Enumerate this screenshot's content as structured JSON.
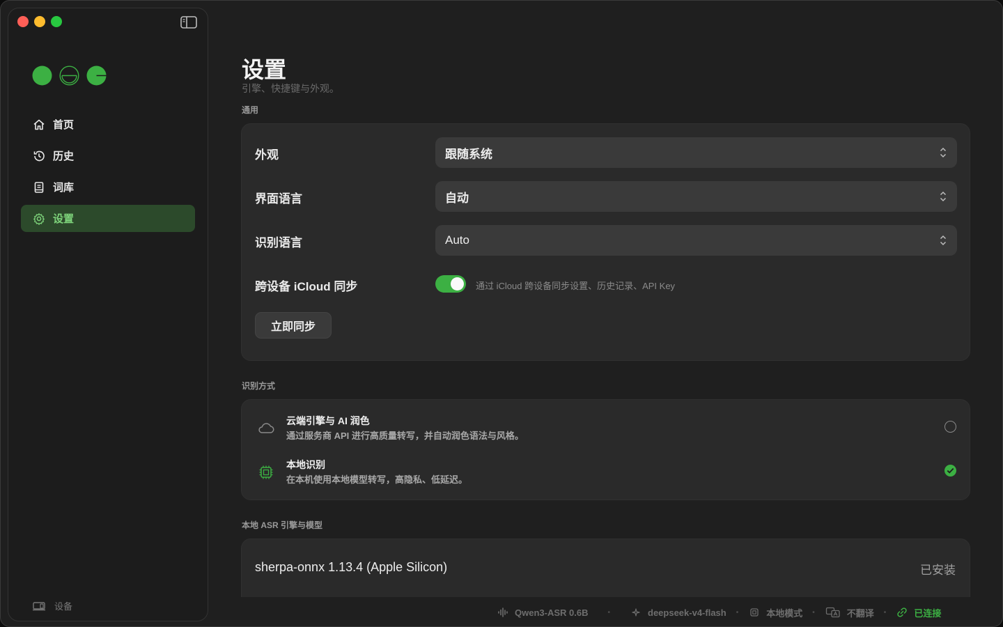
{
  "sidebar": {
    "items": [
      {
        "label": "首页",
        "icon": "home-icon"
      },
      {
        "label": "历史",
        "icon": "history-icon"
      },
      {
        "label": "词库",
        "icon": "book-icon"
      },
      {
        "label": "设置",
        "icon": "gear-icon",
        "active": true
      }
    ],
    "device_label": "设备"
  },
  "page": {
    "title": "设置",
    "subtitle": "引擎、快捷键与外观。"
  },
  "general": {
    "section_label": "通用",
    "appearance": {
      "label": "外观",
      "value": "跟随系统"
    },
    "ui_language": {
      "label": "界面语言",
      "value": "自动"
    },
    "recognition_language": {
      "label": "识别语言",
      "value": "Auto"
    },
    "icloud_sync": {
      "label": "跨设备 iCloud 同步",
      "enabled": true,
      "description": "通过 iCloud 跨设备同步设置、历史记录、API Key"
    },
    "sync_now_button": "立即同步"
  },
  "recognition_mode": {
    "section_label": "识别方式",
    "options": [
      {
        "title": "云端引擎与 AI 润色",
        "description": "通过服务商 API 进行高质量转写，并自动润色语法与风格。",
        "icon": "cloud-icon",
        "selected": false
      },
      {
        "title": "本地识别",
        "description": "在本机使用本地模型转写，高隐私、低延迟。",
        "icon": "chip-icon",
        "selected": true
      }
    ]
  },
  "local_asr": {
    "section_label": "本地 ASR 引擎与模型",
    "engine": "sherpa-onnx 1.13.4 (Apple Silicon)",
    "status": "已安装"
  },
  "statusbar": {
    "asr_model": "Qwen3-ASR 0.6B",
    "llm_model": "deepseek-v4-flash",
    "mode": "本地模式",
    "translation": "不翻译",
    "connection": "已连接"
  },
  "colors": {
    "accent": "#3cb043",
    "active_nav_bg": "#2c4a2b",
    "card_bg": "#2a2a2a",
    "window_bg": "#1f1f1f"
  }
}
